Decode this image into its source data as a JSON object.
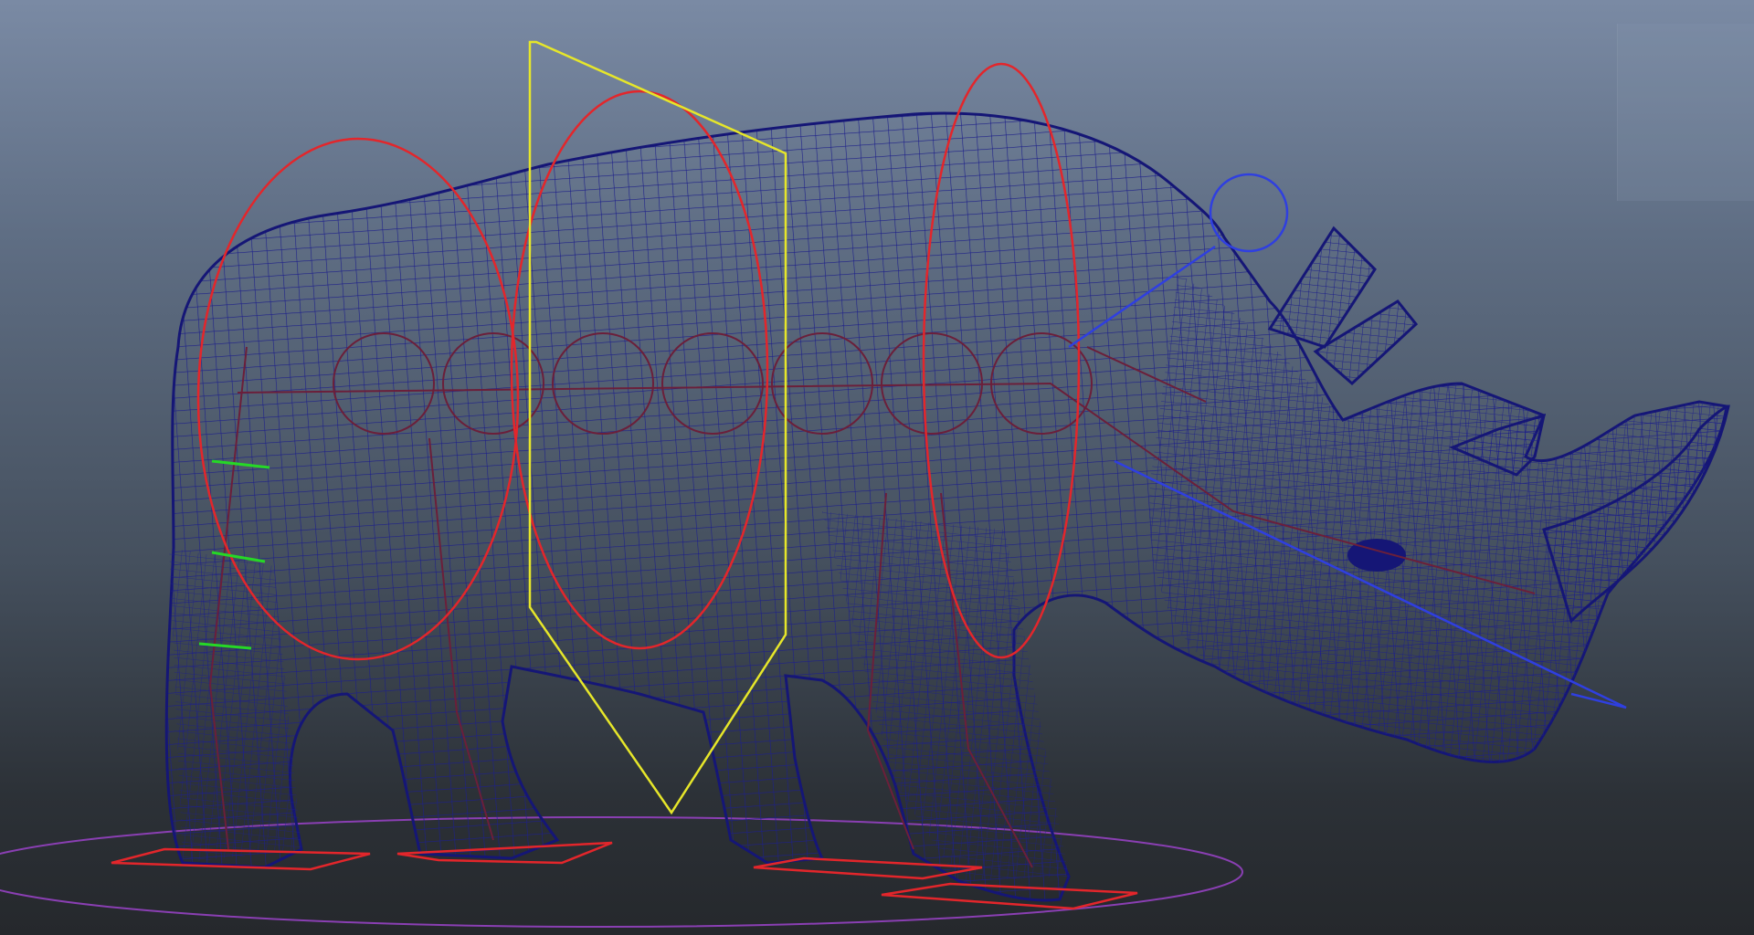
{
  "viewport": {
    "subject": "rhino-wireframe",
    "background_top": "#7a8aa4",
    "background_bottom": "#25282c"
  },
  "colors": {
    "mesh": "#1d1f8a",
    "mesh_dark": "#151676",
    "rig_circle": "#e3262b",
    "skeleton": "#6b1f3a",
    "cog_control": "#e6e62a",
    "head_control": "#2f3fe0",
    "ground_control": "#8a3fb3",
    "foot_control": "#e3262b",
    "ik_marker": "#26d826"
  }
}
